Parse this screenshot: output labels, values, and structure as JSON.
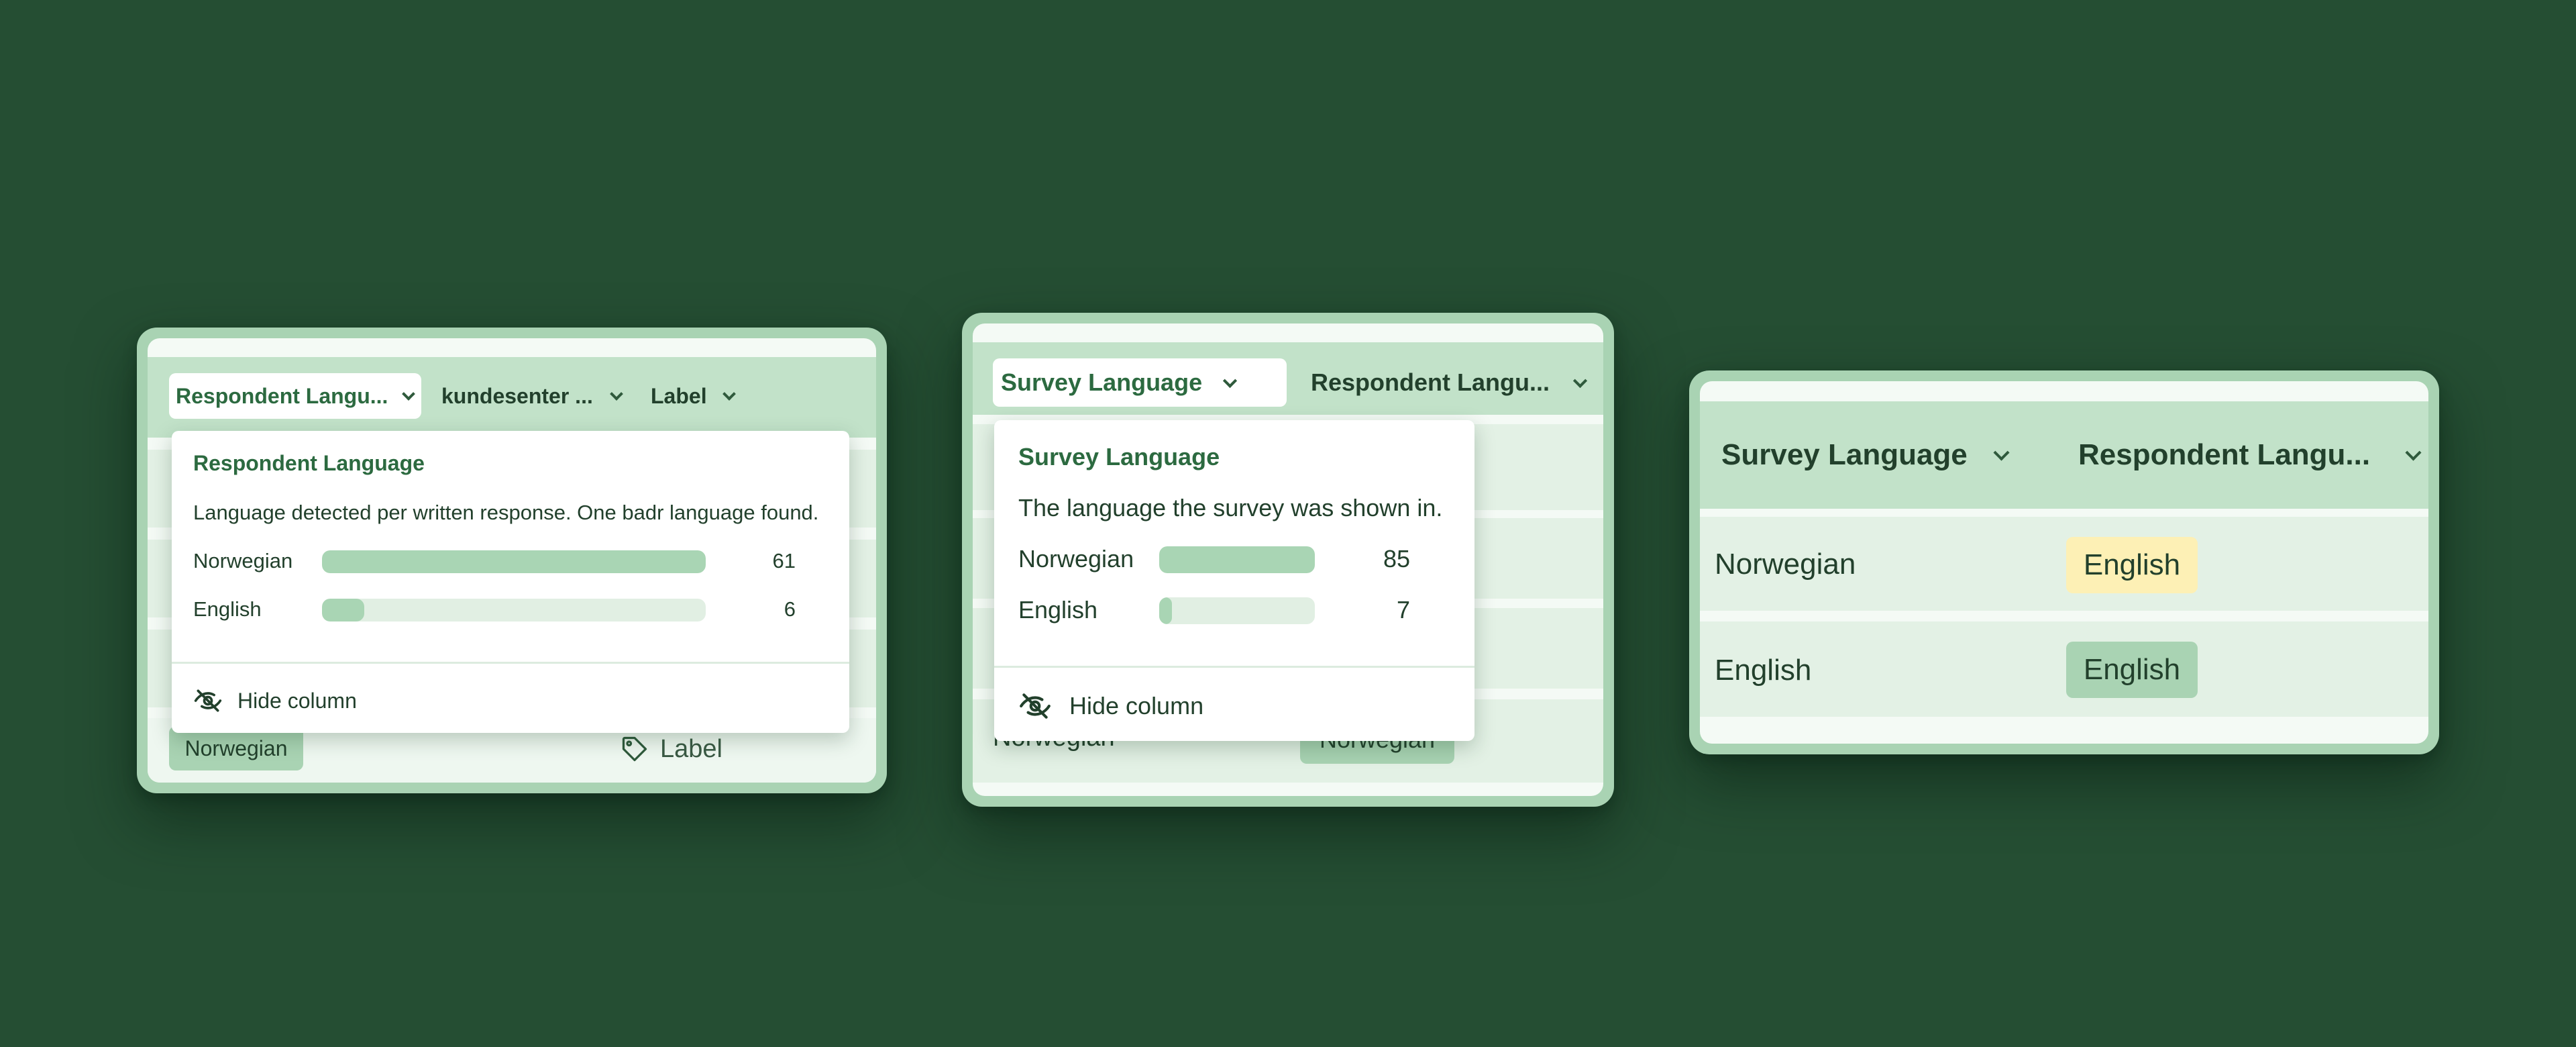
{
  "panel1": {
    "header": {
      "col1_label": "Respondent Langu...",
      "col2_label": "kundesenter ...",
      "col3_label": "Label"
    },
    "popover": {
      "title": "Respondent Language",
      "description": "Language detected per written response. One badr language found.",
      "distribution": [
        {
          "label": "Norwegian",
          "count": "61",
          "fraction": 1.0
        },
        {
          "label": "English",
          "count": "6",
          "fraction": 0.11
        }
      ],
      "hide_label": "Hide column"
    },
    "row": {
      "tag": "Norwegian",
      "label_cell": "Label"
    }
  },
  "panel2": {
    "header": {
      "col1_label": "Survey Language",
      "col2_label": "Respondent Langu..."
    },
    "popover": {
      "title": "Survey Language",
      "description": "The language the survey was shown in.",
      "distribution": [
        {
          "label": "Norwegian",
          "count": "85",
          "fraction": 1.0
        },
        {
          "label": "English",
          "count": "7",
          "fraction": 0.08
        }
      ],
      "hide_label": "Hide column"
    },
    "row": {
      "col1": "Norwegian",
      "col2_tag": "Norwegian"
    }
  },
  "panel3": {
    "header": {
      "col1_label": "Survey Language",
      "col2_label": "Respondent Langu..."
    },
    "rows": [
      {
        "col1": "Norwegian",
        "col2_tag": "English",
        "tag_color": "#fdf0b5"
      },
      {
        "col1": "English",
        "col2_tag": "English",
        "tag_color": "#a9d3b3"
      }
    ]
  },
  "colors": {
    "background": "#254e33",
    "card_frame": "#a9d3b3",
    "accent_green": "#2c6a40",
    "highlight_yellow": "#fdf0b5"
  },
  "icons": {
    "eye_off": "eye-off-icon",
    "tag": "tag-icon",
    "chevron": "chevron-down-icon"
  }
}
